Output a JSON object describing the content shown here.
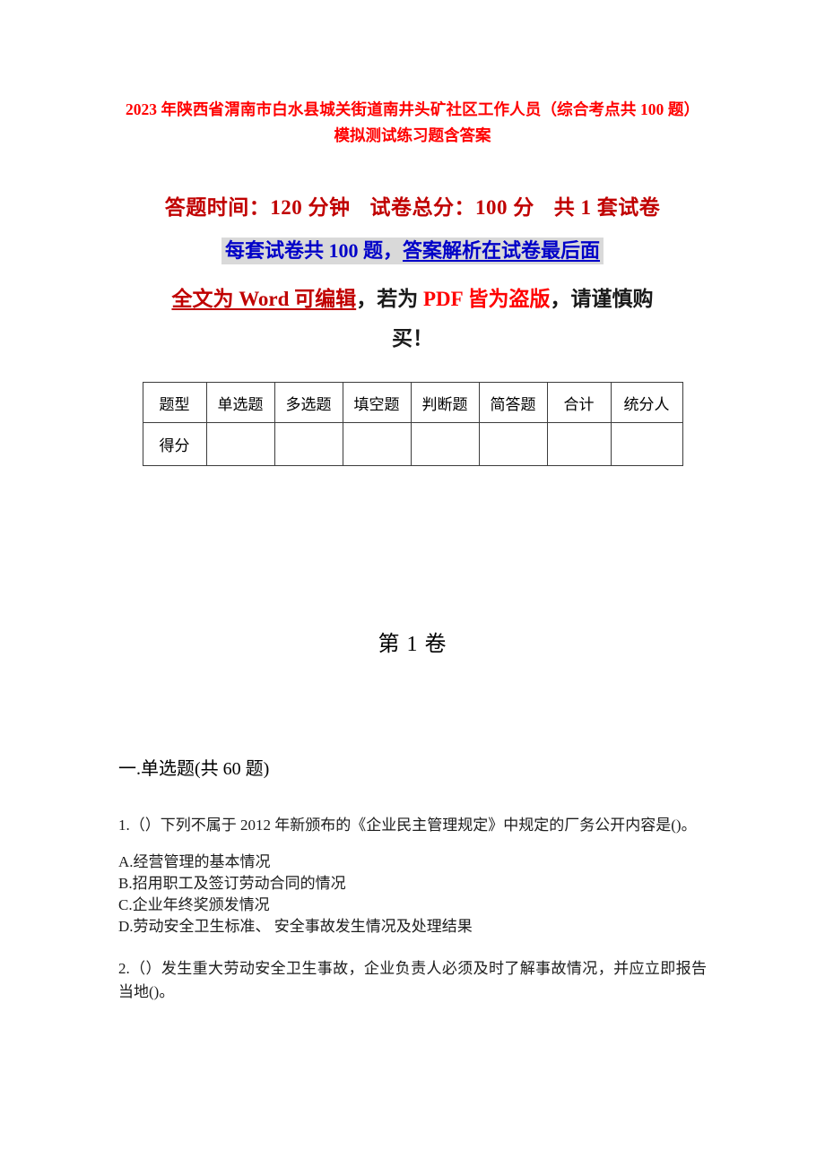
{
  "document": {
    "title": "2023 年陕西省渭南市白水县城关街道南井头矿社区工作人员（综合考点共 100 题）模拟测试练习题含答案"
  },
  "exam_info": {
    "duration_label": "答题时间：120 分钟",
    "total_score_label": "试卷总分：100 分",
    "paper_count_label": "共 1 套试卷",
    "questions_note_plain": "每套试卷共 100 题，",
    "questions_note_underlined": "答案解析在试卷最后面",
    "notice_part1": "全文为 Word 可编辑",
    "notice_part2": "，若为 ",
    "notice_part3": "PDF 皆为盗版",
    "notice_part4": "，请谨慎购",
    "notice_part5": "买！",
    "colors": {
      "title_red": "#FF0000",
      "dark_red": "#C00000",
      "blue": "#0000C8",
      "highlight_gray": "#D9D9D9"
    }
  },
  "score_table": {
    "headers": [
      "题型",
      "单选题",
      "多选题",
      "填空题",
      "判断题",
      "简答题",
      "合计",
      "统分人"
    ],
    "rows": [
      {
        "label": "得分",
        "values": [
          "",
          "",
          "",
          "",
          "",
          "",
          ""
        ]
      }
    ]
  },
  "volume": {
    "label": "第 1 卷"
  },
  "section": {
    "heading": "一.单选题(共 60 题)"
  },
  "questions": [
    {
      "number": "1.",
      "text": "1.（）下列不属于 2012 年新颁布的《企业民主管理规定》中规定的厂务公开内容是()。",
      "options": [
        "A.经营管理的基本情况",
        "B.招用职工及签订劳动合同的情况",
        "C.企业年终奖颁发情况",
        "D.劳动安全卫生标准、 安全事故发生情况及处理结果"
      ]
    },
    {
      "number": "2.",
      "text": "2.（）发生重大劳动安全卫生事故，企业负责人必须及时了解事故情况，并应立即报告当地()。",
      "options": []
    }
  ]
}
